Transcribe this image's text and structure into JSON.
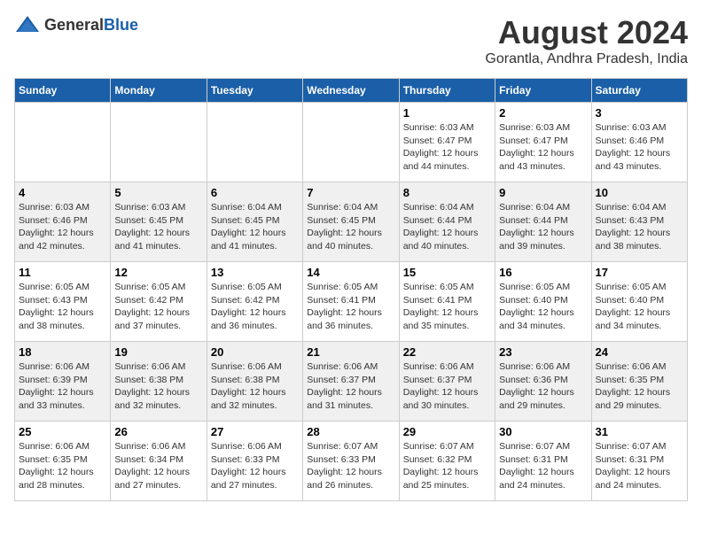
{
  "header": {
    "logo_general": "General",
    "logo_blue": "Blue",
    "month_year": "August 2024",
    "location": "Gorantla, Andhra Pradesh, India"
  },
  "days_of_week": [
    "Sunday",
    "Monday",
    "Tuesday",
    "Wednesday",
    "Thursday",
    "Friday",
    "Saturday"
  ],
  "weeks": [
    [
      {
        "day": "",
        "info": ""
      },
      {
        "day": "",
        "info": ""
      },
      {
        "day": "",
        "info": ""
      },
      {
        "day": "",
        "info": ""
      },
      {
        "day": "1",
        "info": "Sunrise: 6:03 AM\nSunset: 6:47 PM\nDaylight: 12 hours\nand 44 minutes."
      },
      {
        "day": "2",
        "info": "Sunrise: 6:03 AM\nSunset: 6:47 PM\nDaylight: 12 hours\nand 43 minutes."
      },
      {
        "day": "3",
        "info": "Sunrise: 6:03 AM\nSunset: 6:46 PM\nDaylight: 12 hours\nand 43 minutes."
      }
    ],
    [
      {
        "day": "4",
        "info": "Sunrise: 6:03 AM\nSunset: 6:46 PM\nDaylight: 12 hours\nand 42 minutes."
      },
      {
        "day": "5",
        "info": "Sunrise: 6:03 AM\nSunset: 6:45 PM\nDaylight: 12 hours\nand 41 minutes."
      },
      {
        "day": "6",
        "info": "Sunrise: 6:04 AM\nSunset: 6:45 PM\nDaylight: 12 hours\nand 41 minutes."
      },
      {
        "day": "7",
        "info": "Sunrise: 6:04 AM\nSunset: 6:45 PM\nDaylight: 12 hours\nand 40 minutes."
      },
      {
        "day": "8",
        "info": "Sunrise: 6:04 AM\nSunset: 6:44 PM\nDaylight: 12 hours\nand 40 minutes."
      },
      {
        "day": "9",
        "info": "Sunrise: 6:04 AM\nSunset: 6:44 PM\nDaylight: 12 hours\nand 39 minutes."
      },
      {
        "day": "10",
        "info": "Sunrise: 6:04 AM\nSunset: 6:43 PM\nDaylight: 12 hours\nand 38 minutes."
      }
    ],
    [
      {
        "day": "11",
        "info": "Sunrise: 6:05 AM\nSunset: 6:43 PM\nDaylight: 12 hours\nand 38 minutes."
      },
      {
        "day": "12",
        "info": "Sunrise: 6:05 AM\nSunset: 6:42 PM\nDaylight: 12 hours\nand 37 minutes."
      },
      {
        "day": "13",
        "info": "Sunrise: 6:05 AM\nSunset: 6:42 PM\nDaylight: 12 hours\nand 36 minutes."
      },
      {
        "day": "14",
        "info": "Sunrise: 6:05 AM\nSunset: 6:41 PM\nDaylight: 12 hours\nand 36 minutes."
      },
      {
        "day": "15",
        "info": "Sunrise: 6:05 AM\nSunset: 6:41 PM\nDaylight: 12 hours\nand 35 minutes."
      },
      {
        "day": "16",
        "info": "Sunrise: 6:05 AM\nSunset: 6:40 PM\nDaylight: 12 hours\nand 34 minutes."
      },
      {
        "day": "17",
        "info": "Sunrise: 6:05 AM\nSunset: 6:40 PM\nDaylight: 12 hours\nand 34 minutes."
      }
    ],
    [
      {
        "day": "18",
        "info": "Sunrise: 6:06 AM\nSunset: 6:39 PM\nDaylight: 12 hours\nand 33 minutes."
      },
      {
        "day": "19",
        "info": "Sunrise: 6:06 AM\nSunset: 6:38 PM\nDaylight: 12 hours\nand 32 minutes."
      },
      {
        "day": "20",
        "info": "Sunrise: 6:06 AM\nSunset: 6:38 PM\nDaylight: 12 hours\nand 32 minutes."
      },
      {
        "day": "21",
        "info": "Sunrise: 6:06 AM\nSunset: 6:37 PM\nDaylight: 12 hours\nand 31 minutes."
      },
      {
        "day": "22",
        "info": "Sunrise: 6:06 AM\nSunset: 6:37 PM\nDaylight: 12 hours\nand 30 minutes."
      },
      {
        "day": "23",
        "info": "Sunrise: 6:06 AM\nSunset: 6:36 PM\nDaylight: 12 hours\nand 29 minutes."
      },
      {
        "day": "24",
        "info": "Sunrise: 6:06 AM\nSunset: 6:35 PM\nDaylight: 12 hours\nand 29 minutes."
      }
    ],
    [
      {
        "day": "25",
        "info": "Sunrise: 6:06 AM\nSunset: 6:35 PM\nDaylight: 12 hours\nand 28 minutes."
      },
      {
        "day": "26",
        "info": "Sunrise: 6:06 AM\nSunset: 6:34 PM\nDaylight: 12 hours\nand 27 minutes."
      },
      {
        "day": "27",
        "info": "Sunrise: 6:06 AM\nSunset: 6:33 PM\nDaylight: 12 hours\nand 27 minutes."
      },
      {
        "day": "28",
        "info": "Sunrise: 6:07 AM\nSunset: 6:33 PM\nDaylight: 12 hours\nand 26 minutes."
      },
      {
        "day": "29",
        "info": "Sunrise: 6:07 AM\nSunset: 6:32 PM\nDaylight: 12 hours\nand 25 minutes."
      },
      {
        "day": "30",
        "info": "Sunrise: 6:07 AM\nSunset: 6:31 PM\nDaylight: 12 hours\nand 24 minutes."
      },
      {
        "day": "31",
        "info": "Sunrise: 6:07 AM\nSunset: 6:31 PM\nDaylight: 12 hours\nand 24 minutes."
      }
    ]
  ]
}
